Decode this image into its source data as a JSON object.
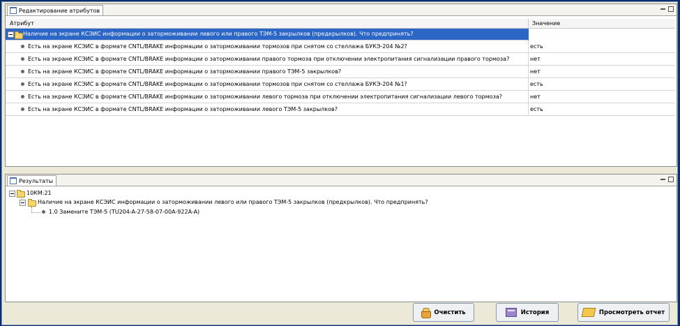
{
  "attributes_panel": {
    "tab_label": "Редактирование атрибутов",
    "columns": {
      "attribute": "Атрибут",
      "value": "Значение"
    },
    "group": {
      "label": "Наличие на экране КСЭИС информации о заторможивании левого или правого ТЭМ-5 закрылков (предкрылков). Что предпринять?",
      "value": ""
    },
    "rows": [
      {
        "attribute": "Есть на экране КСЭИС в формате CNTL/BRAKE информации о заторможивании тормозов при снятом со стеллажа БУКЭ-204 №2?",
        "value": "есть"
      },
      {
        "attribute": "Есть на экране КСЭИС в формате CNTL/BRAKE информации о заторможивании правого тормоза при отключении электропитания сигнализации правого тормоза?",
        "value": "нет"
      },
      {
        "attribute": "Есть на экране КСЭИС в формате CNTL/BRAKE информации о заторможивании правого ТЭМ-5 закрылков?",
        "value": "нет"
      },
      {
        "attribute": "Есть на экране КСЭИС в формате CNTL/BRAKE информации о заторможивании тормозов при снятом со стеллажа БУКЭ-204 №1?",
        "value": "есть"
      },
      {
        "attribute": "Есть на экране КСЭИС в формате CNTL/BRAKE информации о заторможивании левого тормоза при отключении электропитания сигнализации левого тормоза?",
        "value": "нет"
      },
      {
        "attribute": "Есть на экране КСЭИС в формате CNTL/BRAKE информации о заторможивании левого ТЭМ-5 закрылков?",
        "value": "есть"
      }
    ]
  },
  "results_panel": {
    "tab_label": "Результаты",
    "tree": {
      "root": "10КМ:21",
      "child": "Наличие на экране КСЭИС информации о заторможивании левого или правого ТЭМ-5 закрылков (предкрылков). Что предпринять?",
      "leaf": "1.0 Замените ТЭМ-5 (TU204-A-27-58-07-00A-922A-A)"
    }
  },
  "buttons": {
    "clear": "Очистить",
    "history": "История",
    "view_report": "Просмотреть отчет"
  },
  "icons": [
    "window-icon",
    "folder-icon",
    "minimize-icon",
    "maximize-icon",
    "bucket-icon",
    "history-icon",
    "report-icon"
  ]
}
